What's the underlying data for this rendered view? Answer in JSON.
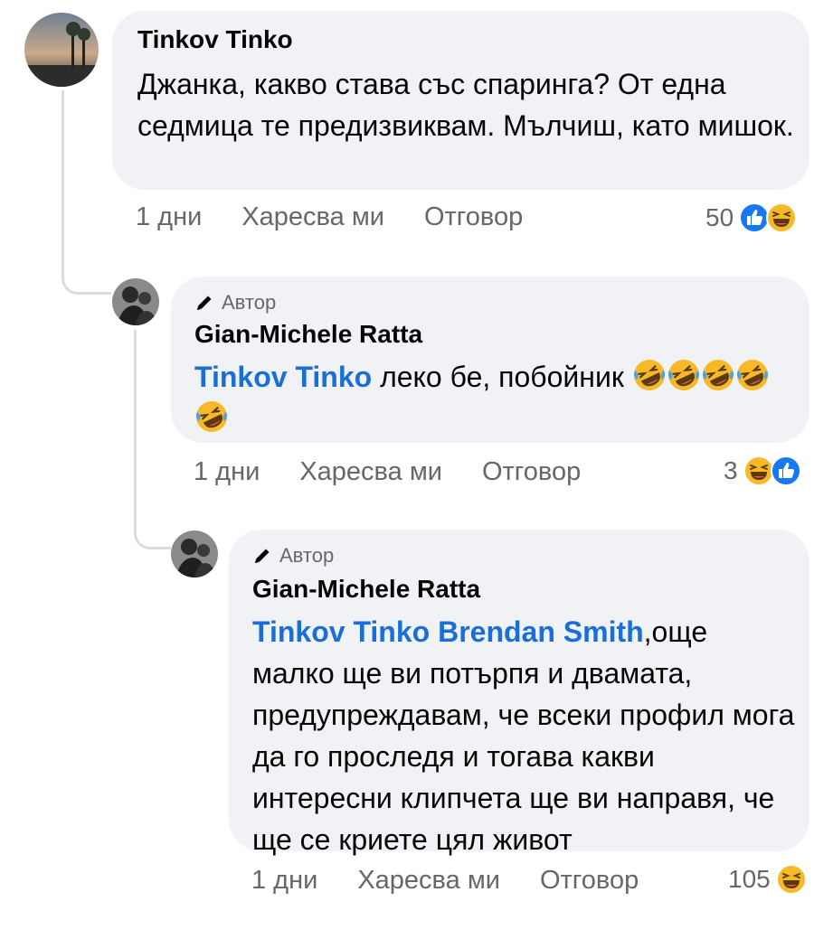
{
  "comments": [
    {
      "author": "Tinkov Tinko",
      "text": "Джанка, какво става със спаринга? От една седмица те предизвиквам. Мълчиш, като мишок.",
      "time": "1 дни",
      "like_label": "Харесва ми",
      "reply_label": "Отговор",
      "reaction_count": "50",
      "reactions": [
        "like-icon",
        "haha-icon"
      ]
    },
    {
      "author_badge": "Автор",
      "author": "Gian-Michele Ratta",
      "mention": "Tinkov Tinko",
      "text": "леко бе, побойник",
      "emojis": [
        "rofl-emoji",
        "rofl-emoji",
        "rofl-emoji",
        "rofl-emoji",
        "rofl-emoji"
      ],
      "time": "1 дни",
      "like_label": "Харесва ми",
      "reply_label": "Отговор",
      "reaction_count": "3",
      "reactions": [
        "haha-icon",
        "like-icon"
      ]
    },
    {
      "author_badge": "Автор",
      "author": "Gian-Michele Ratta",
      "mention": "Tinkov Tinko Brendan Smith",
      "text": ",още малко ще ви потърпя и двамата, предупреждавам, че всеки профил мога да го проследя и тогава какви интересни клипчета ще ви направя, че ще се криете цял живот",
      "time": "1 дни",
      "like_label": "Харесва ми",
      "reply_label": "Отговор",
      "reaction_count": "105",
      "reactions": [
        "haha-icon"
      ]
    }
  ],
  "colors": {
    "bubble_bg": "#f0f2f5",
    "mention": "#1a6ed8",
    "meta_text": "#65676b",
    "like_blue": "#1877f2",
    "haha_yellow": "#f7b928"
  }
}
